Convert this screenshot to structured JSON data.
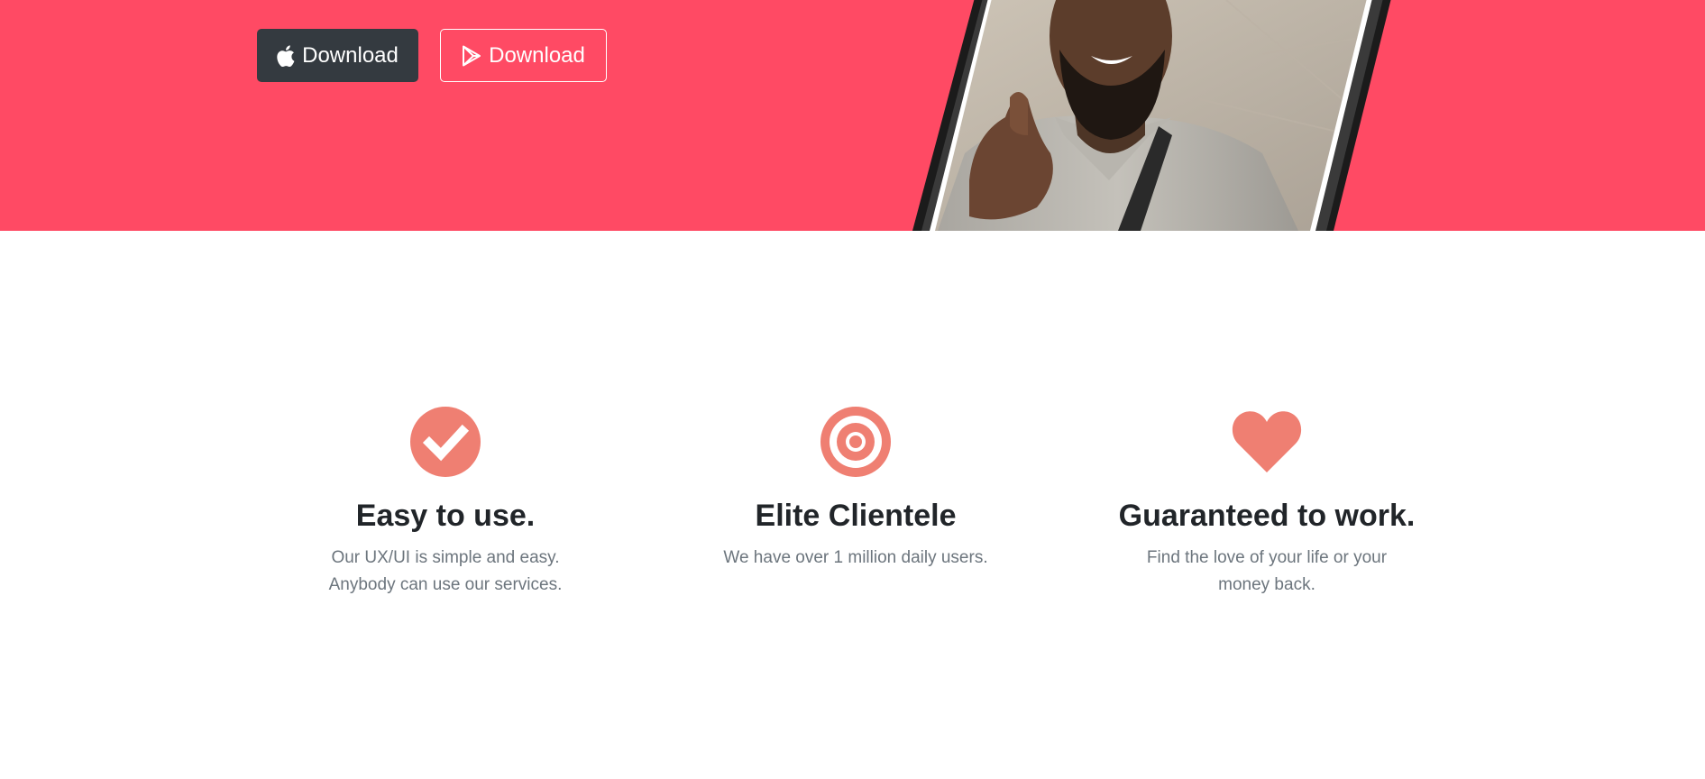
{
  "hero": {
    "background": "#ff4a64",
    "buttons": [
      {
        "label": "Download",
        "icon": "apple-icon"
      },
      {
        "label": "Download",
        "icon": "google-play-icon"
      }
    ]
  },
  "features": {
    "accent_color": "#ef7f72",
    "items": [
      {
        "icon": "check-circle-icon",
        "title": "Easy to use.",
        "text": "Our UX/UI is simple and easy. Anybody can use our services."
      },
      {
        "icon": "target-icon",
        "title": "Elite Clientele",
        "text": "We have over 1 million daily users."
      },
      {
        "icon": "heart-icon",
        "title": "Guaranteed to work.",
        "text": "Find the love of your life or your money back."
      }
    ]
  }
}
